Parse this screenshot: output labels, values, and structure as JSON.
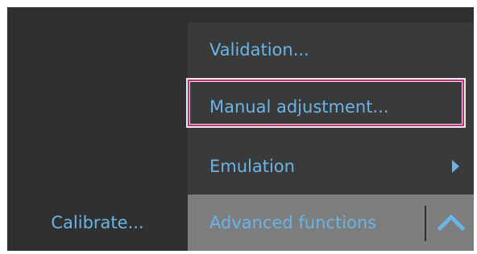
{
  "calibrate": {
    "label": "Calibrate..."
  },
  "menu": {
    "items": [
      {
        "label": "Validation..."
      },
      {
        "label": "Manual adjustment..."
      },
      {
        "label": "Emulation"
      }
    ]
  },
  "advanced": {
    "label": "Advanced functions"
  },
  "icons": {
    "submenu": "chevron-right-icon",
    "collapse": "chevron-up-icon"
  },
  "colors": {
    "accent_text": "#6ab4e8",
    "highlight_border": "#c0307a",
    "panel_bg": "#303030",
    "menu_bg": "#3a3a3a",
    "bar_bg": "#7d7d7d"
  }
}
